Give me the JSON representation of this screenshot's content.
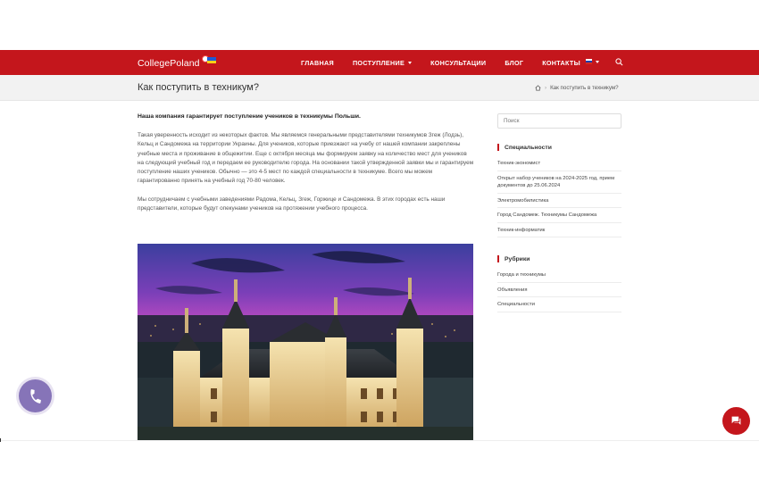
{
  "header": {
    "logo_text": "CollegePoland",
    "brand_color": "#c4161c",
    "menu": [
      {
        "label": "ГЛАВНАЯ",
        "has_dropdown": false
      },
      {
        "label": "ПОСТУПЛЕНИЕ",
        "has_dropdown": true
      },
      {
        "label": "КОНСУЛЬТАЦИИ",
        "has_dropdown": false
      },
      {
        "label": "БЛОГ",
        "has_dropdown": false
      },
      {
        "label": "КОНТАКТЫ",
        "has_dropdown": false
      }
    ],
    "language_icon": "russian-flag-icon",
    "search_icon": "search-icon"
  },
  "subheader": {
    "page_title": "Как поступить в техникум?",
    "breadcrumb_home_icon": "home-icon",
    "breadcrumb_current": "Как поступить в техникум?"
  },
  "article": {
    "lead": "Наша компания гарантирует поступление учеников в техникумы Польши.",
    "paragraph1": "Такая уверенность исходит из некоторых фактов. Мы являемся генеральными представителями техникумов Згеж (Лодзь), Кельц и Сандомежа на территории Украины. Для учеников, которые приезжают на учебу от нашей компании закреплены учебные места и проживание в общежитии. Еще с октября месяца мы формируем заявку на количество мест для учеников на следующий учебный год и передаем ее руководителю города. На основании такой утвержденной заявки мы и гарантируем поступление наших учеников. Обычно — это 4-5 мест по каждой специальности в техникуме. Всего мы можем гарантированно принять на учебный год 70-80 человек.",
    "paragraph2": "Мы сотрудничаем с учебными заведениями Радома, Кельц, Згеж, Горжице и Сандомежа. В этих городах есть наши представители, которые будут опекунами учеников на протяжении учебного процесса."
  },
  "sidebar": {
    "search_placeholder": "Поиск",
    "widget1": {
      "title": "Специальности",
      "items": [
        "Техник-экономист",
        "Открыт набор учеников на 2024-2025 год, прием документов до 25.06.2024",
        "Электромобилистика",
        "Город Сандомеж. Техникумы Сандомежа",
        "Техник-информатик"
      ]
    },
    "widget2": {
      "title": "Рубрики",
      "items": [
        "Города и техникумы",
        "Объявления",
        "Специальности"
      ]
    }
  },
  "floating": {
    "phone_icon": "phone-icon",
    "phone_color": "#8674b8",
    "chat_icon": "chat-icon",
    "chat_color": "#c4161c"
  }
}
